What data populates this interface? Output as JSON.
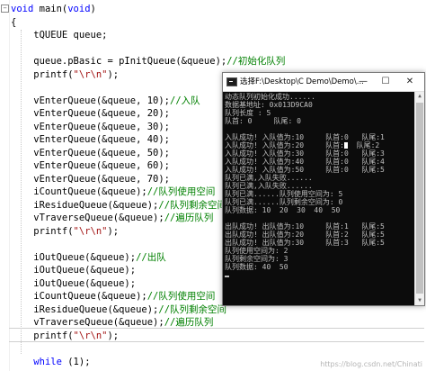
{
  "editor": {
    "lines": [
      {
        "segments": [
          {
            "t": "void",
            "c": "kw"
          },
          {
            "t": " main("
          },
          {
            "t": "void",
            "c": "kw"
          },
          {
            "t": ")"
          }
        ]
      },
      {
        "segments": [
          {
            "t": "{"
          }
        ]
      },
      {
        "segments": [
          {
            "t": "    tQUEUE queue;"
          }
        ]
      },
      {
        "segments": [
          {
            "t": ""
          }
        ]
      },
      {
        "segments": [
          {
            "t": "    queue.pBasic = pInitQueue(&queue);"
          },
          {
            "t": "//初始化队列",
            "c": "cm"
          }
        ]
      },
      {
        "segments": [
          {
            "t": "    printf("
          },
          {
            "t": "\"\\r\\n\"",
            "c": "st"
          },
          {
            "t": ");"
          }
        ]
      },
      {
        "segments": [
          {
            "t": ""
          }
        ]
      },
      {
        "segments": [
          {
            "t": "    vEnterQueue(&queue, 10);"
          },
          {
            "t": "//入队",
            "c": "cm"
          }
        ]
      },
      {
        "segments": [
          {
            "t": "    vEnterQueue(&queue, 20);"
          }
        ]
      },
      {
        "segments": [
          {
            "t": "    vEnterQueue(&queue, 30);"
          }
        ]
      },
      {
        "segments": [
          {
            "t": "    vEnterQueue(&queue, 40);"
          }
        ]
      },
      {
        "segments": [
          {
            "t": "    vEnterQueue(&queue, 50);"
          }
        ]
      },
      {
        "segments": [
          {
            "t": "    vEnterQueue(&queue, 60);"
          }
        ]
      },
      {
        "segments": [
          {
            "t": "    vEnterQueue(&queue, 70);"
          }
        ]
      },
      {
        "segments": [
          {
            "t": "    iCountQueue(&queue);"
          },
          {
            "t": "//队列使用空间",
            "c": "cm"
          }
        ]
      },
      {
        "segments": [
          {
            "t": "    iResidueQueue(&queue);"
          },
          {
            "t": "//队列剩余空间",
            "c": "cm"
          }
        ]
      },
      {
        "segments": [
          {
            "t": "    vTraverseQueue(&queue);"
          },
          {
            "t": "//遍历队列",
            "c": "cm"
          }
        ]
      },
      {
        "segments": [
          {
            "t": "    printf("
          },
          {
            "t": "\"\\r\\n\"",
            "c": "st"
          },
          {
            "t": ");"
          }
        ]
      },
      {
        "segments": [
          {
            "t": ""
          }
        ]
      },
      {
        "segments": [
          {
            "t": "    iOutQueue(&queue);"
          },
          {
            "t": "//出队",
            "c": "cm"
          }
        ]
      },
      {
        "segments": [
          {
            "t": "    iOutQueue(&queue);"
          }
        ]
      },
      {
        "segments": [
          {
            "t": "    iOutQueue(&queue);"
          }
        ]
      },
      {
        "segments": [
          {
            "t": "    iCountQueue(&queue);"
          },
          {
            "t": "//队列使用空间",
            "c": "cm"
          }
        ]
      },
      {
        "segments": [
          {
            "t": "    iResidueQueue(&queue);"
          },
          {
            "t": "//队列剩余空间",
            "c": "cm"
          }
        ]
      },
      {
        "segments": [
          {
            "t": "    vTraverseQueue(&queue);"
          },
          {
            "t": "//遍历队列",
            "c": "cm"
          }
        ]
      },
      {
        "segments": [
          {
            "t": "    printf("
          },
          {
            "t": "\"\\r\\n\"",
            "c": "st"
          },
          {
            "t": ");"
          }
        ]
      },
      {
        "segments": [
          {
            "t": ""
          }
        ]
      },
      {
        "segments": [
          {
            "t": "    "
          },
          {
            "t": "while",
            "c": "kw"
          },
          {
            "t": " (1);"
          }
        ]
      }
    ],
    "fold_glyphs": {
      "main": "−",
      "brace": "−"
    }
  },
  "console": {
    "title": "选择F:\\Desktop\\C Demo\\Demo\\...",
    "buttons": {
      "minimize": "—",
      "maximize": "☐",
      "close": "✕"
    },
    "lines": [
      "动态队列初始化成功......",
      "数据基地址: 0x013D9CA0",
      "队列长度 : 5",
      "队首: 0     队尾: 0",
      "",
      "入队成功! 入队值为:10     队首:0   队尾:1",
      "入队成功! 入队值为:20     队首:",
      "入队成功! 入队值为:30     队首:0   队尾:3",
      "入队成功! 入队值为:40     队首:0   队尾:4",
      "入队成功! 入队值为:50     队首:0   队尾:5",
      "队列已满,入队失败......",
      "队列已满,入队失败......",
      "队列已满......队列使用空间为: 5",
      "队列已满......队列剩余空间为: 0",
      "队列数据: 10  20  30  40  50",
      "",
      "出队成功! 出队值为:10     队首:1   队尾:5",
      "出队成功! 出队值为:20     队首:2   队尾:5",
      "出队成功! 出队值为:30     队首:3   队尾:5",
      "队列使用空间为: 2",
      "队列剩余空间为: 3",
      "队列数据: 40  50"
    ],
    "line7_tail": "  队尾:2"
  },
  "watermark": "https://blog.csdn.net/Chinati"
}
